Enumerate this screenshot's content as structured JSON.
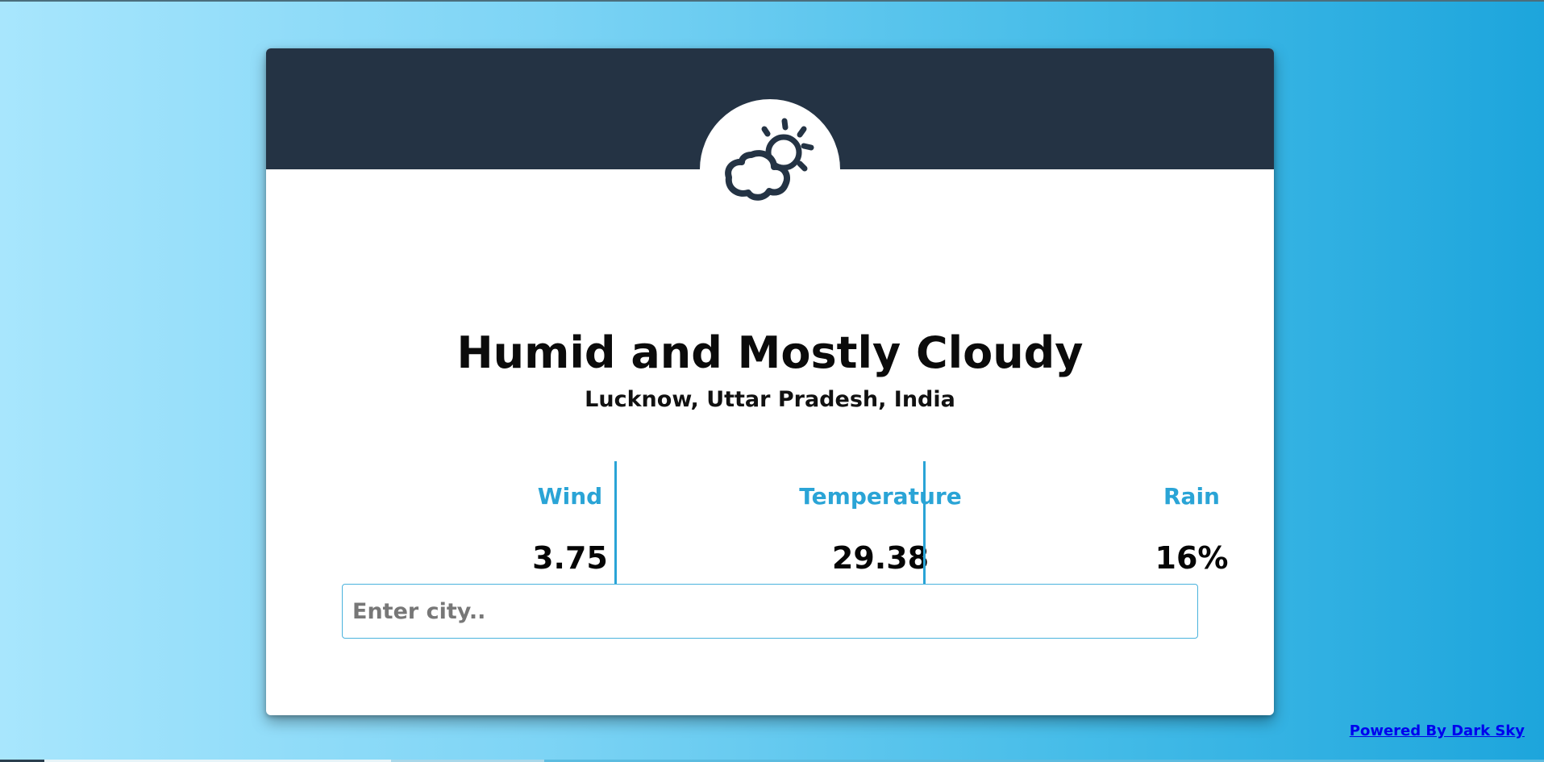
{
  "weather": {
    "icon": "partly-cloudy-day-icon",
    "summary": "Humid and Mostly Cloudy",
    "location": "Lucknow, Uttar Pradesh, India"
  },
  "stats": [
    {
      "label": "Wind",
      "value": "3.75"
    },
    {
      "label": "Temperature",
      "value": "29.38"
    },
    {
      "label": "Rain",
      "value": "16%"
    }
  ],
  "search": {
    "placeholder": "Enter city..",
    "value": ""
  },
  "footer": {
    "powered_by": "Powered By Dark Sky"
  },
  "colors": {
    "header": "#243344",
    "accent": "#2aa4d6",
    "background_start": "#a8e6fd",
    "background_end": "#1da5dc"
  }
}
